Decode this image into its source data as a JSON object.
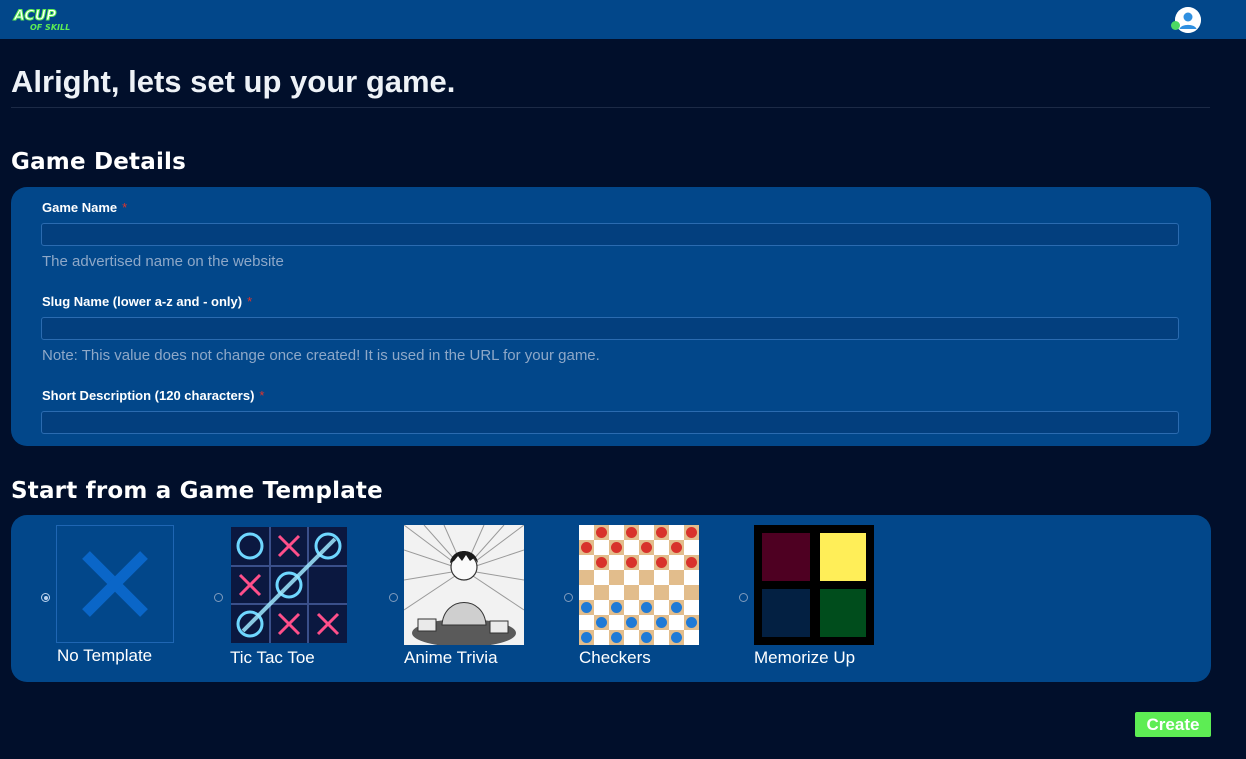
{
  "header": {
    "logo_text_top": "ACUP",
    "logo_text_bottom": "OF SKILL",
    "user_icon": "user-avatar-icon",
    "online_status_color": "#4cd964"
  },
  "page_title": "Alright, lets set up your game.",
  "game_details": {
    "heading": "Game Details",
    "fields": [
      {
        "label": "Game Name",
        "required_mark": "*",
        "value": "",
        "help": "The advertised name on the website"
      },
      {
        "label": "Slug Name (lower a-z and - only)",
        "required_mark": "*",
        "value": "",
        "help": "Note: This value does not change once created! It is used in the URL for your game."
      },
      {
        "label": "Short Description (120 characters)",
        "required_mark": "*",
        "value": ""
      }
    ]
  },
  "templates": {
    "heading": "Start from a Game Template",
    "selected": "No Template",
    "items": [
      {
        "name": "No Template",
        "icon": "x-icon"
      },
      {
        "name": "Tic Tac Toe",
        "icon": "tic-tac-toe-thumbnail"
      },
      {
        "name": "Anime Trivia",
        "icon": "anime-trivia-thumbnail"
      },
      {
        "name": "Checkers",
        "icon": "checkers-thumbnail"
      },
      {
        "name": "Memorize Up",
        "icon": "memorize-up-thumbnail"
      }
    ]
  },
  "actions": {
    "create_label": "Create"
  },
  "colors": {
    "page_bg": "#010f2b",
    "panel_bg": "#02478a",
    "accent_green": "#5ded54",
    "required_red": "#e0342b"
  }
}
